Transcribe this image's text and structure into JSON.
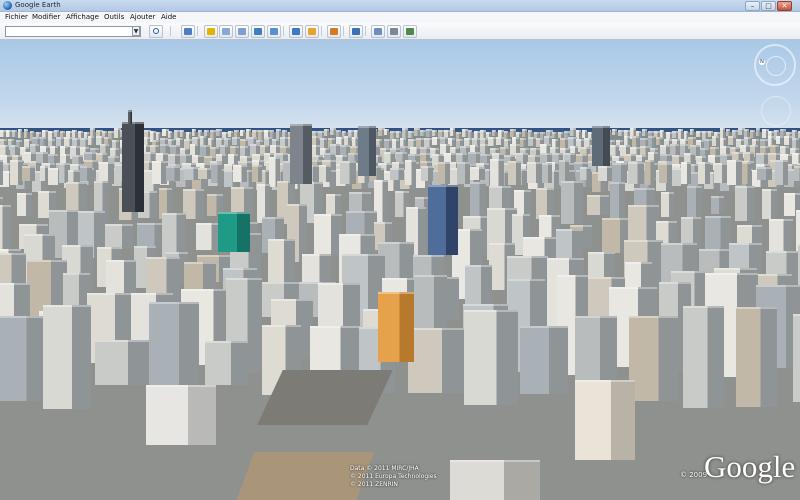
{
  "window": {
    "title": "Google Earth",
    "controls": {
      "minimize": "–",
      "maximize": "□",
      "close": "✕"
    }
  },
  "menu": {
    "items": [
      "Fichier",
      "Modifier",
      "Affichage",
      "Outils",
      "Ajouter",
      "Aide"
    ]
  },
  "toolbar": {
    "search_value": "",
    "buttons": [
      {
        "icon": "sidebar-icon",
        "color": "#4a7ec0"
      },
      {
        "icon": "placemark-icon",
        "color": "#e0b400"
      },
      {
        "icon": "polygon-icon",
        "color": "#8aa7d6"
      },
      {
        "icon": "path-icon",
        "color": "#7fa0cf"
      },
      {
        "icon": "image-overlay-icon",
        "color": "#3f7fc1"
      },
      {
        "icon": "record-tour-icon",
        "color": "#5a8fd0"
      },
      {
        "icon": "historical-imagery-icon",
        "color": "#3b78c7"
      },
      {
        "icon": "sunlight-icon",
        "color": "#e6a52a"
      },
      {
        "icon": "planet-icon",
        "color": "#d57a22"
      },
      {
        "icon": "ruler-icon",
        "color": "#3b6fb6"
      },
      {
        "icon": "email-icon",
        "color": "#6d8fc0"
      },
      {
        "icon": "print-icon",
        "color": "#7a8899"
      },
      {
        "icon": "view-in-maps-icon",
        "color": "#4c8a4c"
      }
    ]
  },
  "viewer": {
    "attribution_line1": "Data © 2011 MIRC/JHA",
    "attribution_line2": "© 2011 Europa Technologies",
    "attribution_line3": "© 2011 ZENRIN",
    "logo_year": "© 2009",
    "logo": "Google",
    "compass_n": "N"
  }
}
